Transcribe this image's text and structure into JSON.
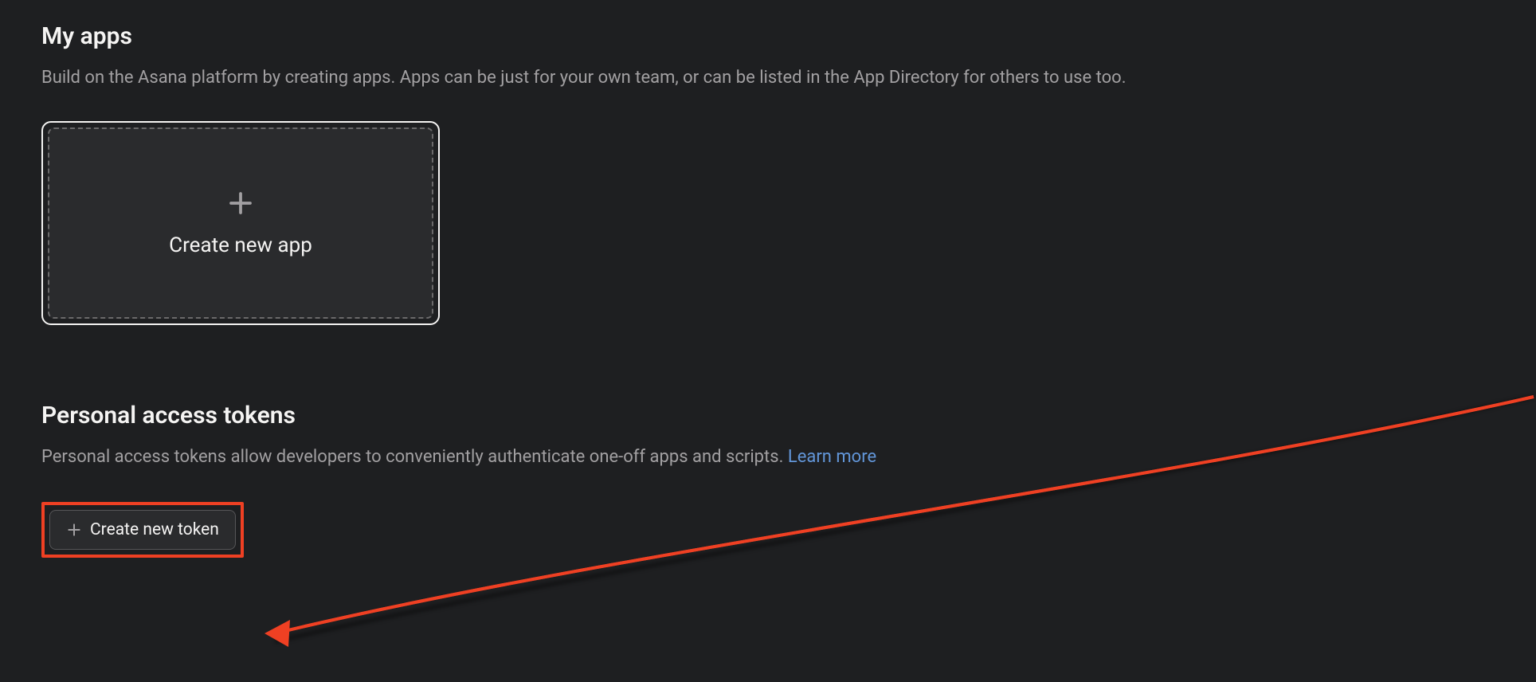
{
  "apps": {
    "title": "My apps",
    "description": "Build on the Asana platform by creating apps. Apps can be just for your own team, or can be listed in the App Directory for others to use too.",
    "create_label": "Create new app"
  },
  "tokens": {
    "title": "Personal access tokens",
    "description": "Personal access tokens allow developers to conveniently authenticate one-off apps and scripts. ",
    "learn_more": "Learn more",
    "create_button": "Create new token"
  }
}
